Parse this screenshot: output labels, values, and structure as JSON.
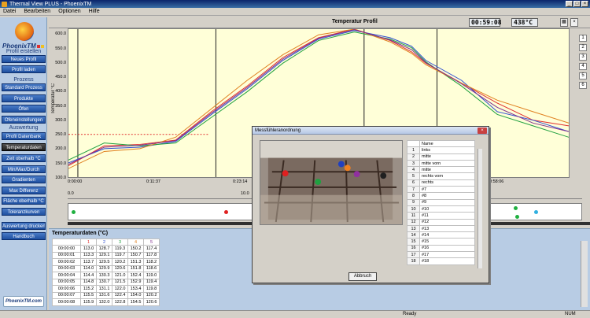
{
  "window": {
    "title": "Thermal View PLUS - PhoenixTM"
  },
  "menu": [
    "Datei",
    "Bearbeiten",
    "Optionen",
    "Hilfe"
  ],
  "sidebar": {
    "brand": "PhoenixTM",
    "section1": "Profil erstellen",
    "section1_buttons": [
      "Neues Profil",
      "Profil laden"
    ],
    "section2": "Prozess",
    "section2_buttons": [
      "Standard Prozess",
      "Produkte",
      "Öfen",
      "Ofeneinstellungen"
    ],
    "section3": "Auswertung",
    "section3_buttons": [
      "Profil Datenbank"
    ],
    "section4_buttons": [
      "Temperaturdaten",
      "Zeit oberhalb °C",
      "Min/Max/Durch",
      "Gradienten",
      "Max Differenz",
      "Fläche oberhalb °C",
      "Toleranzkurven"
    ],
    "section5_buttons": [
      "Auswertung drucken",
      "Handbuch"
    ],
    "footer": "PhoenixTM.com"
  },
  "chart_header": {
    "title": "Temperatur Profil",
    "time_display": "00:59:08",
    "temp_display": "438°C"
  },
  "chart_data": {
    "type": "line",
    "ylabel": "Temperatur °C",
    "yticks": [
      "600.0",
      "550.0",
      "500.0",
      "450.0",
      "400.0",
      "350.0",
      "300.0",
      "250.0",
      "200.0",
      "150.0",
      "100.0"
    ],
    "xticks": [
      "0:00:00",
      "0:11:37",
      "0:23:14",
      "0:46:28",
      "0:58:06"
    ],
    "ylim": [
      100,
      620
    ],
    "x": [
      0,
      5,
      10,
      15,
      20,
      25,
      30,
      35,
      40,
      45,
      48,
      50,
      55,
      60,
      65,
      70
    ],
    "series": [
      {
        "values": [
          140,
          210,
          215,
          230,
          330,
          420,
          520,
          590,
          620,
          580,
          540,
          500,
          430,
          360,
          300,
          280
        ]
      },
      {
        "values": [
          150,
          200,
          205,
          225,
          320,
          410,
          510,
          585,
          615,
          590,
          560,
          510,
          440,
          330,
          300,
          260
        ]
      },
      {
        "values": [
          160,
          220,
          210,
          220,
          310,
          400,
          500,
          580,
          610,
          585,
          555,
          505,
          420,
          320,
          280,
          240
        ]
      },
      {
        "values": [
          130,
          190,
          200,
          240,
          340,
          440,
          530,
          600,
          620,
          575,
          535,
          495,
          430,
          370,
          330,
          290
        ]
      },
      {
        "values": [
          145,
          205,
          212,
          228,
          325,
          415,
          515,
          588,
          618,
          582,
          548,
          502,
          428,
          345,
          290,
          260
        ]
      }
    ],
    "colors": [
      "#e03030",
      "#3050d0",
      "#20a040",
      "#e08020",
      "#803090"
    ]
  },
  "scale_labels": [
    "0.0",
    "10.0"
  ],
  "side_numbers": [
    "1",
    "2",
    "3",
    "4",
    "5",
    "6"
  ],
  "data_panel": {
    "title": "Temperaturdaten (°C)",
    "columns": [
      "1",
      "2",
      "3",
      "4",
      "5"
    ],
    "rows": [
      [
        "00:00:00",
        "113.0",
        "128.7",
        "119.3",
        "150.2",
        "117.4"
      ],
      [
        "00:00:01",
        "113.3",
        "129.1",
        "119.7",
        "150.7",
        "117.8"
      ],
      [
        "00:00:02",
        "113.7",
        "129.5",
        "120.2",
        "151.3",
        "118.2"
      ],
      [
        "00:00:03",
        "114.0",
        "129.9",
        "120.6",
        "151.8",
        "118.6"
      ],
      [
        "00:00:04",
        "114.4",
        "130.3",
        "121.0",
        "152.4",
        "119.0"
      ],
      [
        "00:00:05",
        "114.8",
        "130.7",
        "121.5",
        "152.9",
        "119.4"
      ],
      [
        "00:00:06",
        "115.2",
        "131.1",
        "122.0",
        "153.4",
        "119.8"
      ],
      [
        "00:00:07",
        "115.5",
        "131.6",
        "122.4",
        "154.0",
        "120.2"
      ],
      [
        "00:00:08",
        "115.9",
        "132.0",
        "122.8",
        "154.5",
        "120.6"
      ]
    ]
  },
  "dialog": {
    "title": "Messfühleranordnung",
    "column_header": "Name",
    "rows": [
      [
        "1",
        "links"
      ],
      [
        "2",
        "mitte"
      ],
      [
        "3",
        "mitte vorn"
      ],
      [
        "4",
        "mitte"
      ],
      [
        "5",
        "rechts vorn"
      ],
      [
        "6",
        "rechts"
      ],
      [
        "7",
        "#7"
      ],
      [
        "8",
        "#8"
      ],
      [
        "9",
        "#9"
      ],
      [
        "10",
        "#10"
      ],
      [
        "11",
        "#11"
      ],
      [
        "12",
        "#12"
      ],
      [
        "13",
        "#13"
      ],
      [
        "14",
        "#14"
      ],
      [
        "15",
        "#15"
      ],
      [
        "16",
        "#16"
      ],
      [
        "17",
        "#17"
      ],
      [
        "18",
        "#18"
      ]
    ],
    "cancel_label": "Abbruch"
  },
  "status": {
    "ready": "Ready",
    "num": "NUM"
  }
}
